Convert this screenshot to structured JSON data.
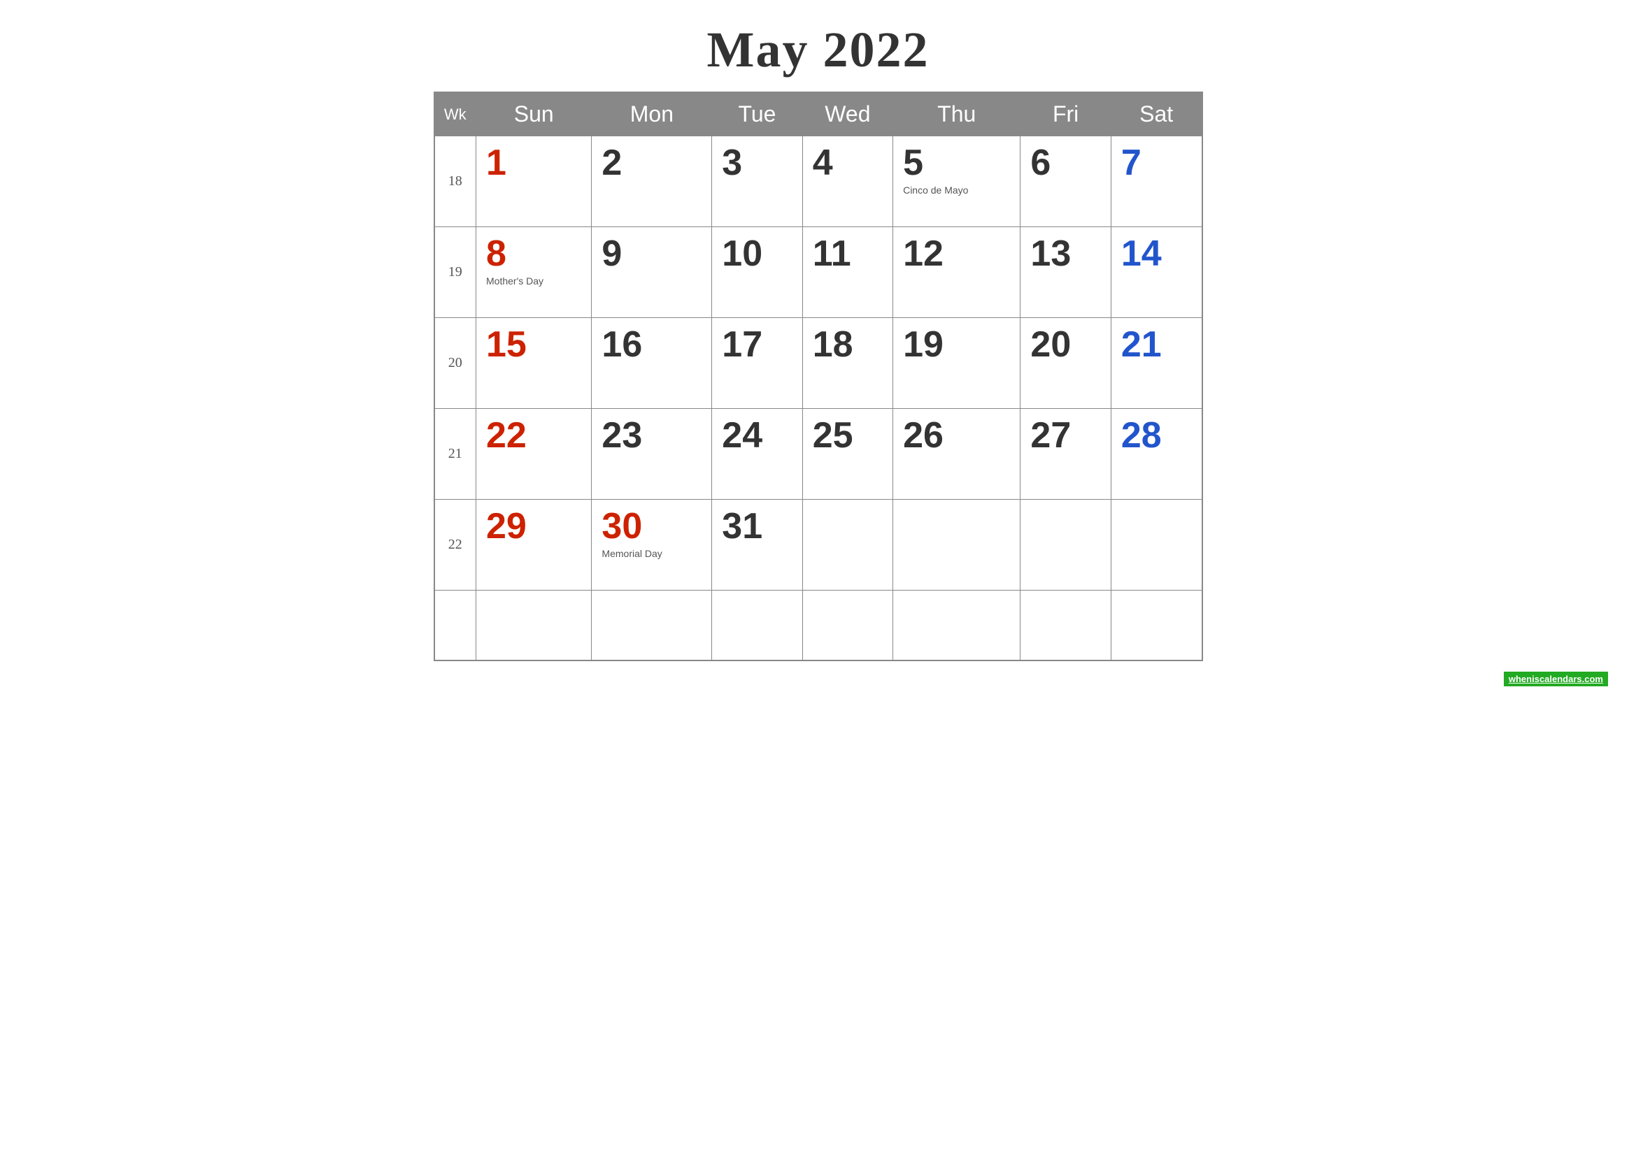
{
  "title": "May 2022",
  "headers": {
    "wk": "Wk",
    "sun": "Sun",
    "mon": "Mon",
    "tue": "Tue",
    "wed": "Wed",
    "thu": "Thu",
    "fri": "Fri",
    "sat": "Sat"
  },
  "weeks": [
    {
      "wk": "18",
      "days": [
        {
          "num": "1",
          "color": "red",
          "holiday": ""
        },
        {
          "num": "2",
          "color": "black",
          "holiday": ""
        },
        {
          "num": "3",
          "color": "black",
          "holiday": ""
        },
        {
          "num": "4",
          "color": "black",
          "holiday": ""
        },
        {
          "num": "5",
          "color": "black",
          "holiday": "Cinco de Mayo"
        },
        {
          "num": "6",
          "color": "black",
          "holiday": ""
        },
        {
          "num": "7",
          "color": "blue",
          "holiday": ""
        }
      ]
    },
    {
      "wk": "19",
      "days": [
        {
          "num": "8",
          "color": "red",
          "holiday": "Mother's Day"
        },
        {
          "num": "9",
          "color": "black",
          "holiday": ""
        },
        {
          "num": "10",
          "color": "black",
          "holiday": ""
        },
        {
          "num": "11",
          "color": "black",
          "holiday": ""
        },
        {
          "num": "12",
          "color": "black",
          "holiday": ""
        },
        {
          "num": "13",
          "color": "black",
          "holiday": ""
        },
        {
          "num": "14",
          "color": "blue",
          "holiday": ""
        }
      ]
    },
    {
      "wk": "20",
      "days": [
        {
          "num": "15",
          "color": "red",
          "holiday": ""
        },
        {
          "num": "16",
          "color": "black",
          "holiday": ""
        },
        {
          "num": "17",
          "color": "black",
          "holiday": ""
        },
        {
          "num": "18",
          "color": "black",
          "holiday": ""
        },
        {
          "num": "19",
          "color": "black",
          "holiday": ""
        },
        {
          "num": "20",
          "color": "black",
          "holiday": ""
        },
        {
          "num": "21",
          "color": "blue",
          "holiday": ""
        }
      ]
    },
    {
      "wk": "21",
      "days": [
        {
          "num": "22",
          "color": "red",
          "holiday": ""
        },
        {
          "num": "23",
          "color": "black",
          "holiday": ""
        },
        {
          "num": "24",
          "color": "black",
          "holiday": ""
        },
        {
          "num": "25",
          "color": "black",
          "holiday": ""
        },
        {
          "num": "26",
          "color": "black",
          "holiday": ""
        },
        {
          "num": "27",
          "color": "black",
          "holiday": ""
        },
        {
          "num": "28",
          "color": "blue",
          "holiday": ""
        }
      ]
    },
    {
      "wk": "22",
      "days": [
        {
          "num": "29",
          "color": "red",
          "holiday": ""
        },
        {
          "num": "30",
          "color": "red",
          "holiday": "Memorial Day"
        },
        {
          "num": "31",
          "color": "black",
          "holiday": ""
        },
        {
          "num": "",
          "color": "black",
          "holiday": ""
        },
        {
          "num": "",
          "color": "black",
          "holiday": ""
        },
        {
          "num": "",
          "color": "black",
          "holiday": ""
        },
        {
          "num": "",
          "color": "black",
          "holiday": ""
        }
      ]
    }
  ],
  "watermark": {
    "text": "wheniscalendars.com",
    "url": "#"
  }
}
